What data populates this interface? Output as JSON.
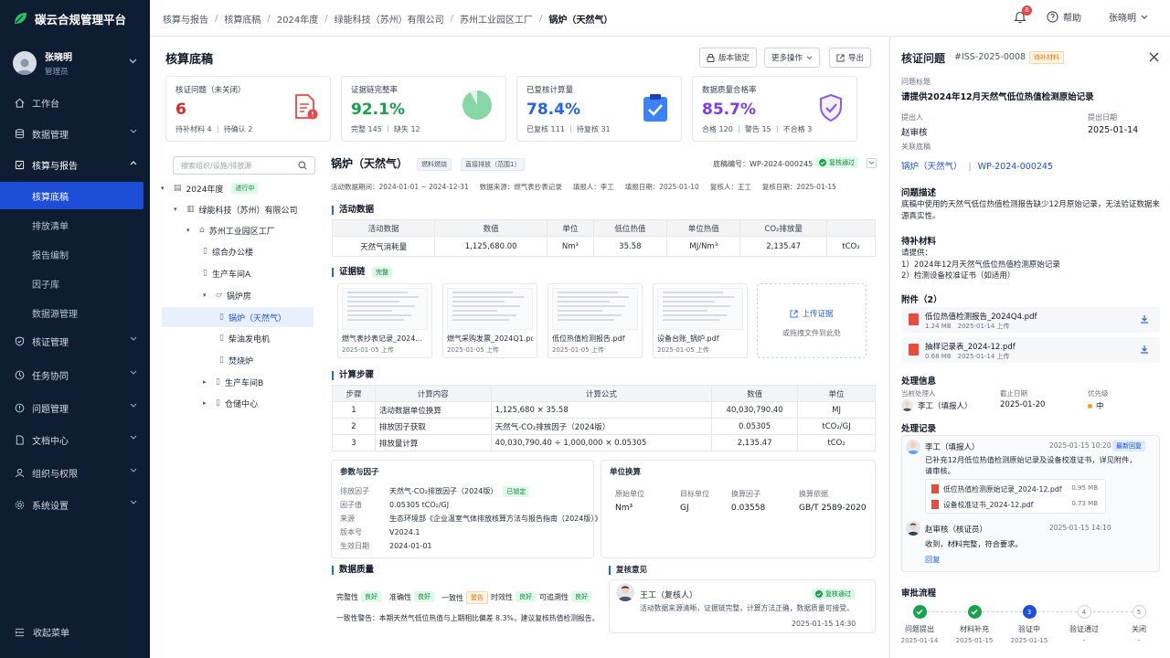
{
  "app": {
    "title": "碳云合规管理平台"
  },
  "user": {
    "name": "张晓明",
    "role": "管理员"
  },
  "nav": [
    {
      "label": "工作台"
    },
    {
      "label": "数据管理"
    },
    {
      "label": "核算与报告"
    },
    {
      "label": "核证管理"
    },
    {
      "label": "任务协同"
    },
    {
      "label": "问题管理"
    },
    {
      "label": "文档中心"
    },
    {
      "label": "组织与权限"
    },
    {
      "label": "系统设置"
    }
  ],
  "subnav": [
    {
      "label": "核算底稿"
    },
    {
      "label": "排放清单"
    },
    {
      "label": "报告编制"
    },
    {
      "label": "因子库"
    },
    {
      "label": "数据源管理"
    }
  ],
  "collapse_label": "收起菜单",
  "breadcrumb": [
    "核算与报告",
    "核算底稿",
    "2024年度",
    "绿能科技（苏州）有限公司",
    "苏州工业园区工厂",
    "锅炉（天然气）"
  ],
  "header": {
    "notif_count": "8",
    "help": "帮助",
    "user": "张晓明"
  },
  "page": {
    "title": "核算底稿",
    "lock_btn": "版本锁定",
    "more_btn": "更多操作",
    "export_btn": "导出"
  },
  "cards": [
    {
      "title": "核证问题（未关闭）",
      "value": "6",
      "sub": "待补材料 4 ｜ 待确认 2",
      "color": "#dc2626"
    },
    {
      "title": "证据链完整率",
      "value": "92.1%",
      "sub": "完整 145 ｜ 缺失 12",
      "color": "#16a34a",
      "pct": 0.921
    },
    {
      "title": "已复核计算量",
      "value": "78.4%",
      "sub": "已复核 111 ｜ 待复核 31",
      "color": "#2563eb"
    },
    {
      "title": "数据质量合格率",
      "value": "85.7%",
      "sub": "合格 120 ｜ 警告 15 ｜ 不合格 3",
      "color": "#7c3aed"
    }
  ],
  "tree": {
    "search_placeholder": "搜索组织/设施/排放源",
    "nodes": [
      {
        "label": "2024年度",
        "tag": "进行中"
      },
      {
        "label": "绿能科技（苏州）有限公司"
      },
      {
        "label": "苏州工业园区工厂"
      },
      {
        "label": "综合办公楼"
      },
      {
        "label": "生产车间A"
      },
      {
        "label": "锅炉房"
      },
      {
        "label": "锅炉（天然气）"
      },
      {
        "label": "柴油发电机"
      },
      {
        "label": "焚烧炉"
      },
      {
        "label": "生产车间B"
      },
      {
        "label": "仓储中心"
      }
    ]
  },
  "detail": {
    "title": "锅炉（天然气）",
    "tag1": "燃料燃烧",
    "tag2": "直接排放（范围1）",
    "code": "底稿编号：WP-2024-000245",
    "status": "复核通过",
    "meta": [
      "活动数据期间：2024-01-01 ~ 2024-12-31",
      "数据来源：燃气表抄表记录",
      "填报人：李工",
      "填报日期：2025-01-10",
      "复核人：王工",
      "复核日期：2025-01-15"
    ]
  },
  "activity": {
    "title": "活动数据",
    "headers": [
      "活动数据",
      "数值",
      "单位",
      "低位热值",
      "单位热值",
      "CO₂排放量",
      ""
    ],
    "row": [
      "天然气消耗量",
      "1,125,680.00",
      "Nm³",
      "35.58",
      "MJ/Nm³",
      "2,135.47",
      "tCO₂"
    ]
  },
  "evidence": {
    "title": "证据链",
    "tag": "完整",
    "files": [
      {
        "name": "燃气表抄表记录_2024...",
        "date": "2025-01-05 上传"
      },
      {
        "name": "燃气采购发票_2024Q1.pdf",
        "date": "2025-01-05 上传"
      },
      {
        "name": "低位热值检测报告.pdf",
        "date": "2025-01-05 上传"
      },
      {
        "name": "设备台账_锅炉.pdf",
        "date": "2025-01-05 上传"
      }
    ],
    "upload": "上传证据",
    "drop": "或拖拽文件到此处"
  },
  "calc": {
    "title": "计算步骤",
    "headers": [
      "步骤",
      "计算内容",
      "计算公式",
      "数值",
      "单位"
    ],
    "rows": [
      [
        "1",
        "活动数据单位换算",
        "1,125,680 × 35.58",
        "40,030,790.40",
        "MJ"
      ],
      [
        "2",
        "排放因子获取",
        "天然气-CO₂排放因子（2024版）",
        "0.05305",
        "tCO₂/GJ"
      ],
      [
        "3",
        "排放量计算",
        "40,030,790.40 ÷ 1,000,000 × 0.05305",
        "2,135.47",
        "tCO₂"
      ]
    ]
  },
  "params": {
    "title": "参数与因子",
    "tag": "已锁定",
    "rows": [
      {
        "k": "排放因子",
        "v": "天然气-CO₂排放因子（2024版）"
      },
      {
        "k": "因子值",
        "v": "0.05305 tCO₂/GJ"
      },
      {
        "k": "来源",
        "v": "生态环境部《企业温室气体排放核算方法与报告指南（2024版）》"
      },
      {
        "k": "版本号",
        "v": "V2024.1"
      },
      {
        "k": "生效日期",
        "v": "2024-01-01"
      }
    ]
  },
  "unit": {
    "title": "单位换算",
    "headers": [
      "原始单位",
      "目标单位",
      "换算因子",
      "换算依据"
    ],
    "row": [
      "Nm³",
      "GJ",
      "0.03558",
      "GB/T 2589-2020"
    ]
  },
  "quality": {
    "title": "数据质量",
    "items": [
      {
        "k": "完整性",
        "v": "良好"
      },
      {
        "k": "准确性",
        "v": "良好"
      },
      {
        "k": "一致性",
        "v": "警告"
      },
      {
        "k": "时效性",
        "v": "良好"
      },
      {
        "k": "可追溯性",
        "v": "良好"
      }
    ],
    "warn": "一致性警告：本期天然气低位热值与上期相比偏差 8.3%，建议复核热值检测报告。"
  },
  "review": {
    "title": "复核意见",
    "name": "王工（复核人）",
    "status": "复核通过",
    "text": "活动数据来源清晰，证据链完整，计算方法正确，数据质量可接受。",
    "time": "2025-01-15 14:30"
  },
  "panel": {
    "title": "核证问题",
    "id": "#ISS-2025-0008",
    "tag": "待补材料",
    "q_label": "问题标题",
    "q_title": "请提供2024年12月天然气低位热值检测原始记录",
    "by_label": "提出人",
    "by": "赵审核",
    "date_label": "提出日期",
    "date": "2025-01-14",
    "rel_label": "关联底稿",
    "rel1": "锅炉（天然气）",
    "rel2": "WP-2024-000245",
    "desc_title": "问题描述",
    "desc": "底稿中使用的天然气低位热值检测报告缺少12月原始记录，无法验证数据来源真实性。",
    "need_title": "待补材料",
    "need_intro": "请提供：",
    "need": [
      "1）2024年12月天然气低位热值检测原始记录",
      "2）检测设备校准证书（如适用）"
    ],
    "att_title": "附件（2）",
    "atts": [
      {
        "name": "低位热值检测报告_2024Q4.pdf",
        "meta": "1.24 MB　2025-01-14 上传"
      },
      {
        "name": "抽样记录表_2024-12.pdf",
        "meta": "0.68 MB　2025-01-14 上传"
      }
    ],
    "handle_title": "处理信息",
    "h_cur_label": "当前处理人",
    "h_cur": "李工（填报人）",
    "h_due_label": "截止日期",
    "h_due": "2025-01-20",
    "h_pri_label": "优先级",
    "h_pri": "中",
    "log_title": "处理记录",
    "log1": {
      "name": "李工（填报人）",
      "time": "2025-01-15 10:20",
      "tag": "最新回复",
      "text1": "已补充12月低位热值检测原始记录及设备校准证书，详见附件，",
      "text2": "请审核。",
      "files": [
        {
          "name": "低位热值检测原始记录_2024-12.pdf",
          "size": "0.95 MB"
        },
        {
          "name": "设备校准证书_2024-12.pdf",
          "size": "0.73 MB"
        }
      ]
    },
    "log2": {
      "name": "赵审核（核证员）",
      "time": "2025-01-15 14:10",
      "text": "收到，材料完整，符合要求。",
      "reply": "回复"
    },
    "flow_title": "审批流程",
    "steps": [
      {
        "label": "问题提出",
        "date": "2025-01-14",
        "state": "done"
      },
      {
        "label": "材料补充",
        "date": "2025-01-15",
        "state": "done"
      },
      {
        "label": "验证中",
        "date": "2025-01-15",
        "state": "current",
        "num": "3"
      },
      {
        "label": "验证通过",
        "date": "-",
        "state": "todo",
        "num": "4"
      },
      {
        "label": "关闭",
        "date": "-",
        "state": "todo",
        "num": "5"
      }
    ]
  }
}
